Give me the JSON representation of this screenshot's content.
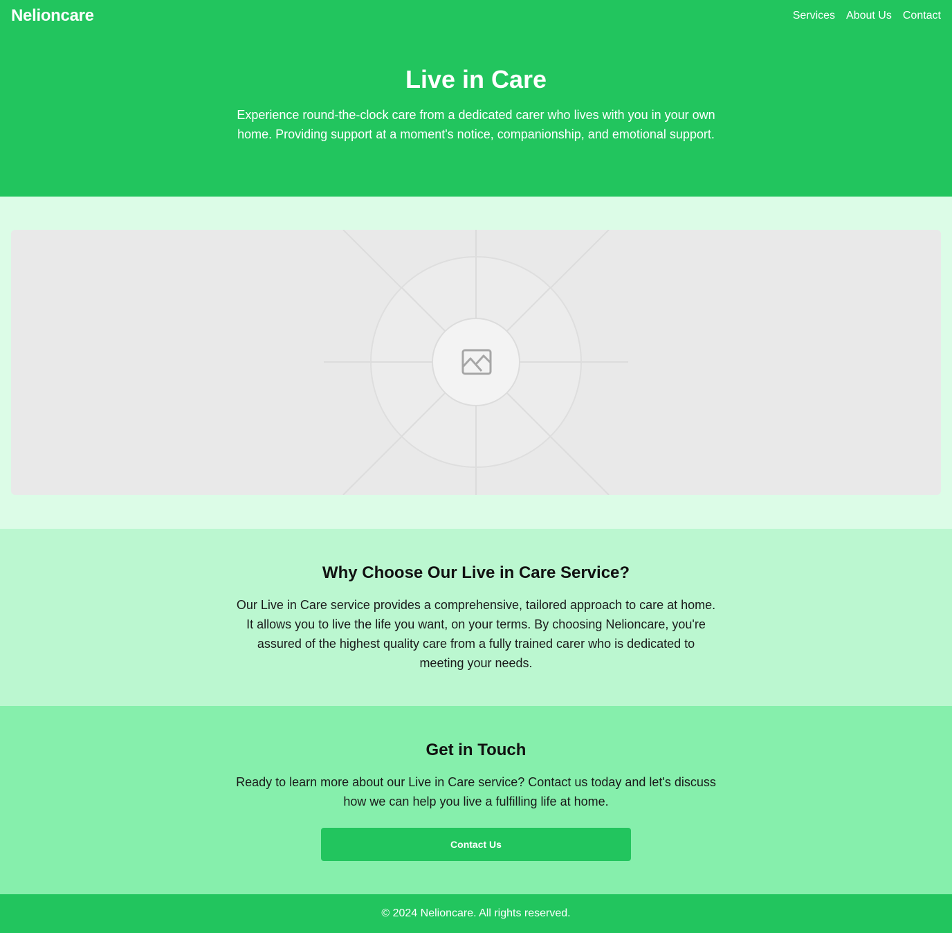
{
  "header": {
    "brand": "Nelioncare",
    "nav": [
      "Services",
      "About Us",
      "Contact"
    ]
  },
  "hero": {
    "title": "Live in Care",
    "text": "Experience round-the-clock care from a dedicated carer who lives with you in your own home. Providing support at a moment's notice, companionship, and emotional support."
  },
  "image": {
    "icon": "image-placeholder-icon"
  },
  "why": {
    "title": "Why Choose Our Live in Care Service?",
    "text": "Our Live in Care service provides a comprehensive, tailored approach to care at home. It allows you to live the life you want, on your terms. By choosing Nelioncare, you're assured of the highest quality care from a fully trained carer who is dedicated to meeting your needs."
  },
  "contact": {
    "title": "Get in Touch",
    "text": "Ready to learn more about our Live in Care service? Contact us today and let's discuss how we can help you live a fulfilling life at home.",
    "button": "Contact Us"
  },
  "footer": {
    "text": "© 2024 Nelioncare. All rights reserved."
  },
  "colors": {
    "primary": "#22c55e",
    "light": "#dcfce7",
    "mid": "#bbf7d0",
    "strong": "#86efac"
  }
}
